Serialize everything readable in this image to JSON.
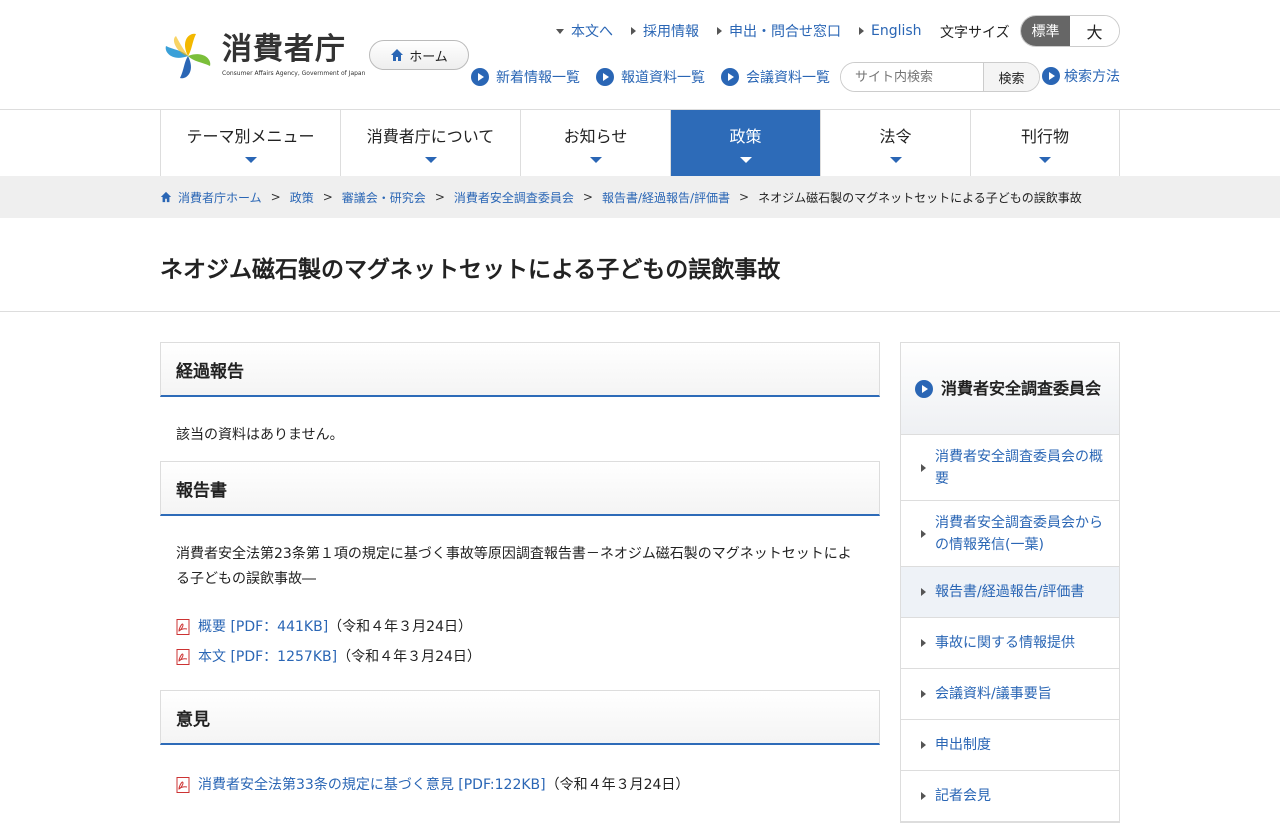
{
  "logo": {
    "title": "消費者庁",
    "subtitle": "Consumer Affairs Agency, Government of Japan"
  },
  "header": {
    "home_label": "ホーム",
    "top_links": [
      "本文へ",
      "採用情報",
      "申出・問合せ窓口",
      "English"
    ],
    "font_size_label": "文字サイズ",
    "font_size_standard": "標準",
    "font_size_large": "大",
    "sub_links": [
      "新着情報一覧",
      "報道資料一覧",
      "会議資料一覧"
    ],
    "search_placeholder": "サイト内検索",
    "search_button": "検索",
    "search_help": "検索方法"
  },
  "gnav": [
    {
      "label": "テーマ別メニュー"
    },
    {
      "label": "消費者庁について"
    },
    {
      "label": "お知らせ"
    },
    {
      "label": "政策"
    },
    {
      "label": "法令"
    },
    {
      "label": "刊行物"
    }
  ],
  "breadcrumb": {
    "items": [
      "消費者庁ホーム",
      "政策",
      "審議会・研究会",
      "消費者安全調査委員会",
      "報告書/経過報告/評価書"
    ],
    "current": "ネオジム磁石製のマグネットセットによる子どもの誤飲事故"
  },
  "page_title": "ネオジム磁石製のマグネットセットによる子どもの誤飲事故",
  "sections": {
    "progress": {
      "heading": "経過報告",
      "message": "該当の資料はありません。"
    },
    "report": {
      "heading": "報告書",
      "description": "消費者安全法第23条第１項の規定に基づく事故等原因調査報告書－ネオジム磁石製のマグネットセットによる子どもの誤飲事故―",
      "files": [
        {
          "link": "概要 [PDF：441KB]",
          "date": "（令和４年３月24日）"
        },
        {
          "link": "本文 [PDF：1257KB]",
          "date": "（令和４年３月24日）"
        }
      ]
    },
    "opinion": {
      "heading": "意見",
      "files": [
        {
          "link": "消費者安全法第33条の規定に基づく意見 [PDF:122KB]",
          "date": "（令和４年３月24日）"
        }
      ]
    }
  },
  "sidebar": {
    "heading": "消費者安全調査委員会",
    "items": [
      {
        "label": "消費者安全調査委員会の概要"
      },
      {
        "label": "消費者安全調査委員会からの情報発信(一葉)"
      },
      {
        "label": "報告書/経過報告/評価書"
      },
      {
        "label": "事故に関する情報提供"
      },
      {
        "label": "会議資料/議事要旨"
      },
      {
        "label": "申出制度"
      },
      {
        "label": "記者会見"
      }
    ]
  },
  "colors": {
    "accent": "#2d6bb8",
    "link": "#2a66b5"
  }
}
